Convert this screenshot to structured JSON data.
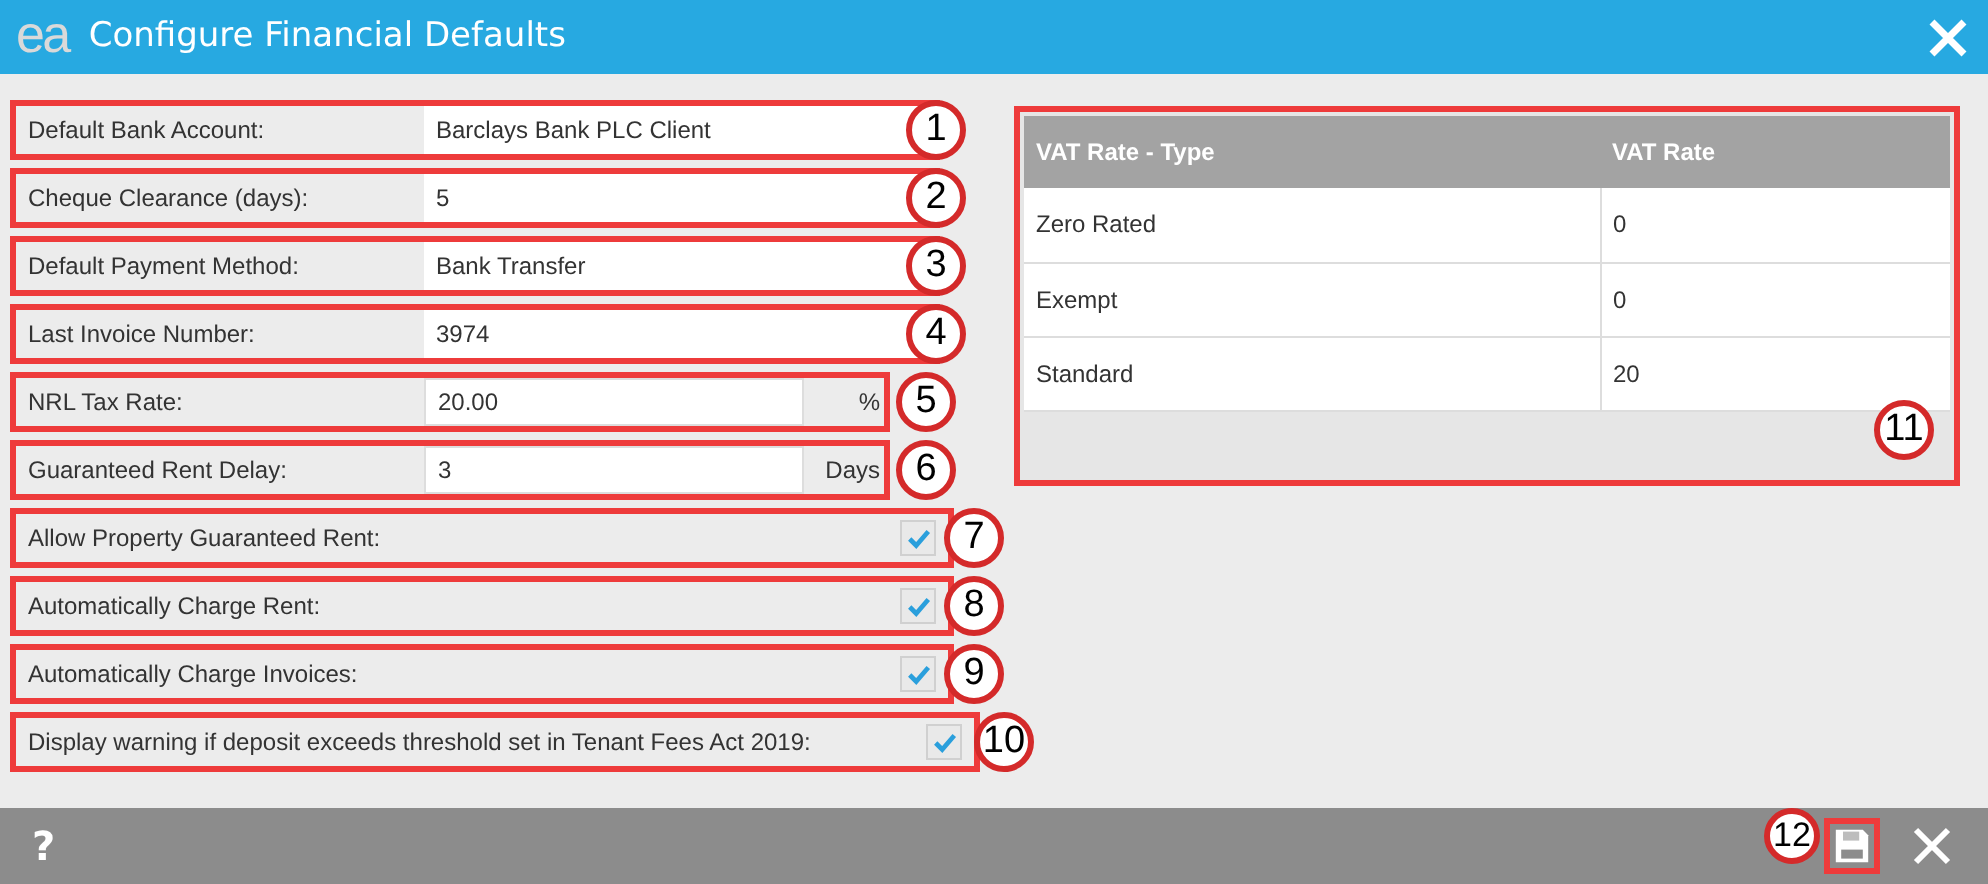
{
  "window": {
    "title": "Configure Financial Defaults",
    "logo": "ea"
  },
  "fields": [
    {
      "kind": "text",
      "label": "Default Bank Account:",
      "value": "Barclays Bank PLC Client",
      "callout": "1"
    },
    {
      "kind": "text",
      "label": "Cheque Clearance (days):",
      "value": "5",
      "callout": "2"
    },
    {
      "kind": "text",
      "label": "Default Payment Method:",
      "value": "Bank Transfer",
      "callout": "3"
    },
    {
      "kind": "text",
      "label": "Last Invoice Number:",
      "value": "3974",
      "callout": "4"
    },
    {
      "kind": "unit",
      "label": "NRL Tax Rate:",
      "value": "20.00",
      "unit": "%",
      "callout": "5"
    },
    {
      "kind": "unit",
      "label": "Guaranteed Rent Delay:",
      "value": "3",
      "unit": "Days",
      "callout": "6"
    },
    {
      "kind": "checkbox",
      "label": "Allow Property Guaranteed Rent:",
      "checked": true,
      "callout": "7"
    },
    {
      "kind": "checkbox",
      "label": "Automatically Charge Rent:",
      "checked": true,
      "callout": "8"
    },
    {
      "kind": "checkbox",
      "label": "Automatically Charge Invoices:",
      "checked": true,
      "callout": "9"
    },
    {
      "kind": "checkbox",
      "label": "Display warning if deposit exceeds threshold set in Tenant Fees Act 2019:",
      "checked": true,
      "callout": "10"
    }
  ],
  "vat_table": {
    "columns": [
      "VAT Rate - Type",
      "VAT Rate"
    ],
    "rows": [
      [
        "Zero Rated",
        "0"
      ],
      [
        "Exempt",
        "0"
      ],
      [
        "Standard",
        "20"
      ]
    ],
    "callout": "11"
  },
  "footer": {
    "help": "?",
    "callout": "12"
  }
}
